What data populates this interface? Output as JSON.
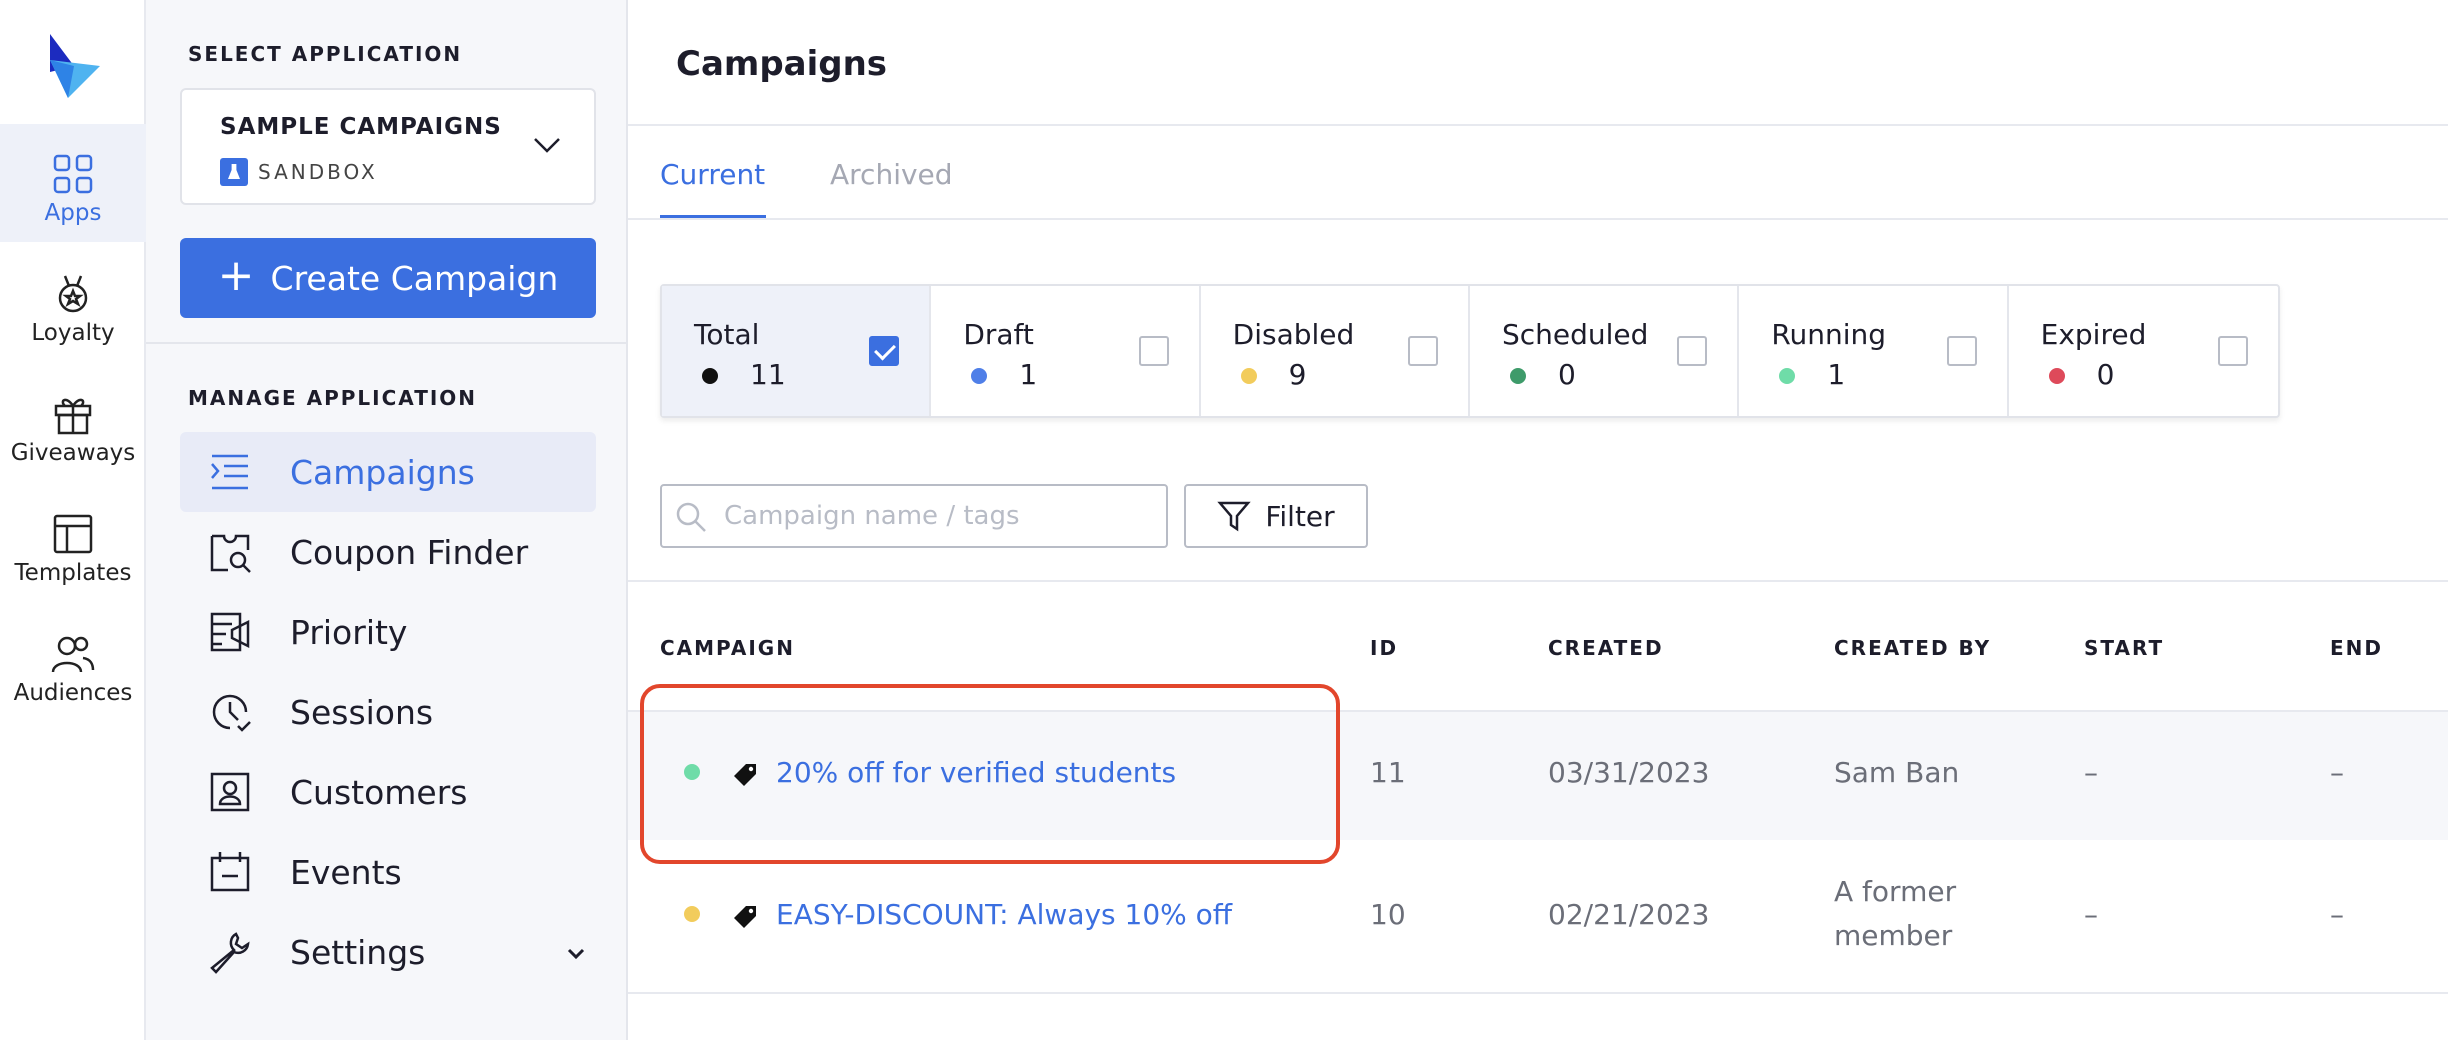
{
  "rail": {
    "items": [
      {
        "label": "Apps",
        "icon": "apps-grid-icon",
        "active": true
      },
      {
        "label": "Loyalty",
        "icon": "medal-icon"
      },
      {
        "label": "Giveaways",
        "icon": "gift-icon"
      },
      {
        "label": "Templates",
        "icon": "layout-template-icon"
      },
      {
        "label": "Audiences",
        "icon": "users-icon"
      }
    ]
  },
  "sidebar": {
    "select_title": "SELECT APPLICATION",
    "app_name": "SAMPLE CAMPAIGNS",
    "app_env": "SANDBOX",
    "create_label": "Create Campaign",
    "manage_title": "MANAGE APPLICATION",
    "nav": [
      {
        "label": "Campaigns",
        "icon": "list-icon",
        "active": true
      },
      {
        "label": "Coupon Finder",
        "icon": "coupon-search-icon"
      },
      {
        "label": "Priority",
        "icon": "priority-icon"
      },
      {
        "label": "Sessions",
        "icon": "clock-icon"
      },
      {
        "label": "Customers",
        "icon": "customer-icon"
      },
      {
        "label": "Events",
        "icon": "calendar-icon"
      },
      {
        "label": "Settings",
        "icon": "wrench-icon"
      }
    ]
  },
  "main": {
    "title": "Campaigns",
    "tabs": [
      {
        "label": "Current"
      },
      {
        "label": "Archived"
      }
    ],
    "statuses": [
      {
        "label": "Total",
        "count": "11",
        "color": "#111111",
        "checked": true
      },
      {
        "label": "Draft",
        "count": "1",
        "color": "#4f7fe8"
      },
      {
        "label": "Disabled",
        "count": "9",
        "color": "#f2cc5c"
      },
      {
        "label": "Scheduled",
        "count": "0",
        "color": "#3e9b6a"
      },
      {
        "label": "Running",
        "count": "1",
        "color": "#6fdca8"
      },
      {
        "label": "Expired",
        "count": "0",
        "color": "#de4a5a"
      }
    ],
    "search_placeholder": "Campaign name / tags",
    "filter_label": "Filter",
    "columns": {
      "campaign": "CAMPAIGN",
      "id": "ID",
      "created": "CREATED",
      "created_by": "CREATED BY",
      "start": "START",
      "end": "END"
    },
    "rows": [
      {
        "name": "20% off for verified students",
        "status_color": "#6fdca8",
        "id": "11",
        "created": "03/31/2023",
        "created_by_1": "Sam Ban",
        "created_by_2": "",
        "start": "–",
        "end": "–"
      },
      {
        "name": "EASY-DISCOUNT: Always 10% off",
        "status_color": "#f2cc5c",
        "id": "10",
        "created": "02/21/2023",
        "created_by_1": "A former",
        "created_by_2": "member",
        "start": "–",
        "end": "–"
      }
    ]
  }
}
